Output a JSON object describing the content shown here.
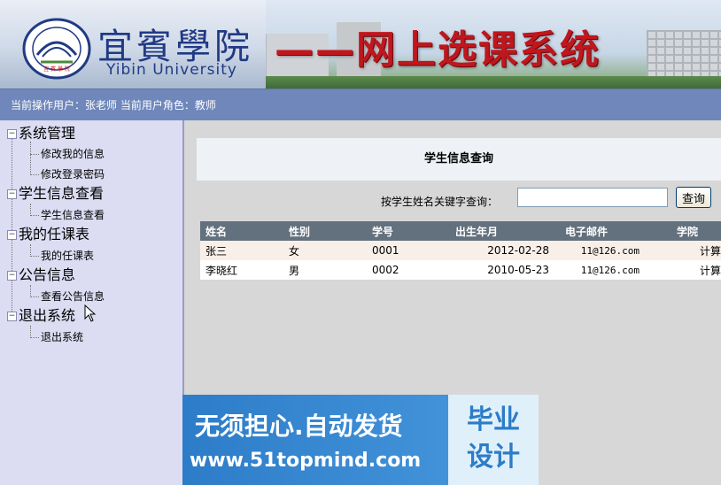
{
  "header": {
    "school_name_cn": "宜賓學院",
    "school_name_en": "Yibin University",
    "system_title": "——网上选课系统",
    "logo_text": "YIBIN UNIVERSITY"
  },
  "userbar": {
    "text": "当前操作用户：张老师  当前用户角色：教师"
  },
  "sidebar": {
    "groups": [
      {
        "label": "系统管理",
        "items": [
          {
            "label": "修改我的信息"
          },
          {
            "label": "修改登录密码"
          }
        ]
      },
      {
        "label": "学生信息查看",
        "items": [
          {
            "label": "学生信息查看"
          }
        ]
      },
      {
        "label": "我的任课表",
        "items": [
          {
            "label": "我的任课表"
          }
        ]
      },
      {
        "label": "公告信息",
        "items": [
          {
            "label": "查看公告信息"
          }
        ]
      },
      {
        "label": "退出系统",
        "items": [
          {
            "label": "退出系统"
          }
        ]
      }
    ]
  },
  "main": {
    "title": "学生信息查询",
    "search": {
      "label": "按学生姓名关键字查询：",
      "value": "",
      "button": "查询"
    },
    "table": {
      "columns": [
        "姓名",
        "性别",
        "学号",
        "出生年月",
        "电子邮件",
        "学院"
      ],
      "rows": [
        [
          "张三",
          "女",
          "0001",
          "2012-02-28",
          "11@126.com",
          "计算"
        ],
        [
          "李晓红",
          "男",
          "0002",
          "2010-05-23",
          "11@126.com",
          "计算"
        ]
      ]
    }
  },
  "watermark": {
    "line1": "无须担心.自动发货",
    "line2": "www.51topmind.com",
    "badge_line1": "毕业",
    "badge_line2": "设计"
  },
  "colors": {
    "userbar_bg": "#6f87bb",
    "sidebar_bg": "#dcdcf2",
    "table_header_bg": "#63707d",
    "title_red": "#c0161d",
    "school_blue": "#203a84"
  }
}
